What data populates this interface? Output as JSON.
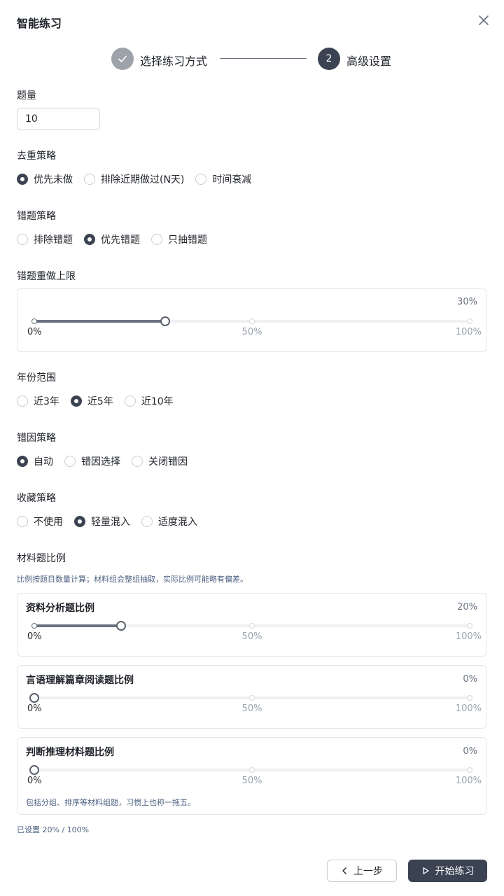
{
  "dialog": {
    "title": "智能练习"
  },
  "steps": [
    {
      "label": "选择练习方式"
    },
    {
      "number": "2",
      "label": "高级设置"
    }
  ],
  "question_count": {
    "label": "题量",
    "value": "10"
  },
  "dedup": {
    "label": "去重策略",
    "options": [
      "优先未做",
      "排除近期做过(N天)",
      "时间衰减"
    ],
    "selected": 0
  },
  "wrong": {
    "label": "错题策略",
    "options": [
      "排除错题",
      "优先错题",
      "只抽错题"
    ],
    "selected": 1
  },
  "redo_limit": {
    "label": "错题重做上限",
    "value_text": "30%",
    "value": 30,
    "marks": [
      "0%",
      "50%",
      "100%"
    ]
  },
  "year_range": {
    "label": "年份范围",
    "options": [
      "近3年",
      "近5年",
      "近10年"
    ],
    "selected": 1
  },
  "error_cause": {
    "label": "错因策略",
    "options": [
      "自动",
      "错因选择",
      "关闭错因"
    ],
    "selected": 0
  },
  "favorites": {
    "label": "收藏策略",
    "options": [
      "不使用",
      "轻量混入",
      "适度混入"
    ],
    "selected": 1
  },
  "material": {
    "label": "材料题比例",
    "hint": "比例按题目数量计算；材料组会整组抽取，实际比例可能略有偏差。",
    "cards": [
      {
        "title": "资料分析题比例",
        "value_text": "20%",
        "value": 20,
        "marks": [
          "0%",
          "50%",
          "100%"
        ]
      },
      {
        "title": "言语理解篇章阅读题比例",
        "value_text": "0%",
        "value": 0,
        "marks": [
          "0%",
          "50%",
          "100%"
        ]
      },
      {
        "title": "判断推理材料题比例",
        "value_text": "0%",
        "value": 0,
        "marks": [
          "0%",
          "50%",
          "100%"
        ],
        "note": "包括分组、排序等材料组题，习惯上也称一拖五。"
      }
    ],
    "summary": "已设置 20% / 100%"
  },
  "footer": {
    "prev_label": "上一步",
    "start_label": "开始练习"
  },
  "colors": {
    "primary": "#3b4353",
    "step_done": "#9ea3aa",
    "hint": "#4b5f80"
  },
  "icons": {
    "close": "close-icon",
    "check": "check-icon",
    "prev": "chevron-left-icon",
    "start": "play-icon"
  }
}
